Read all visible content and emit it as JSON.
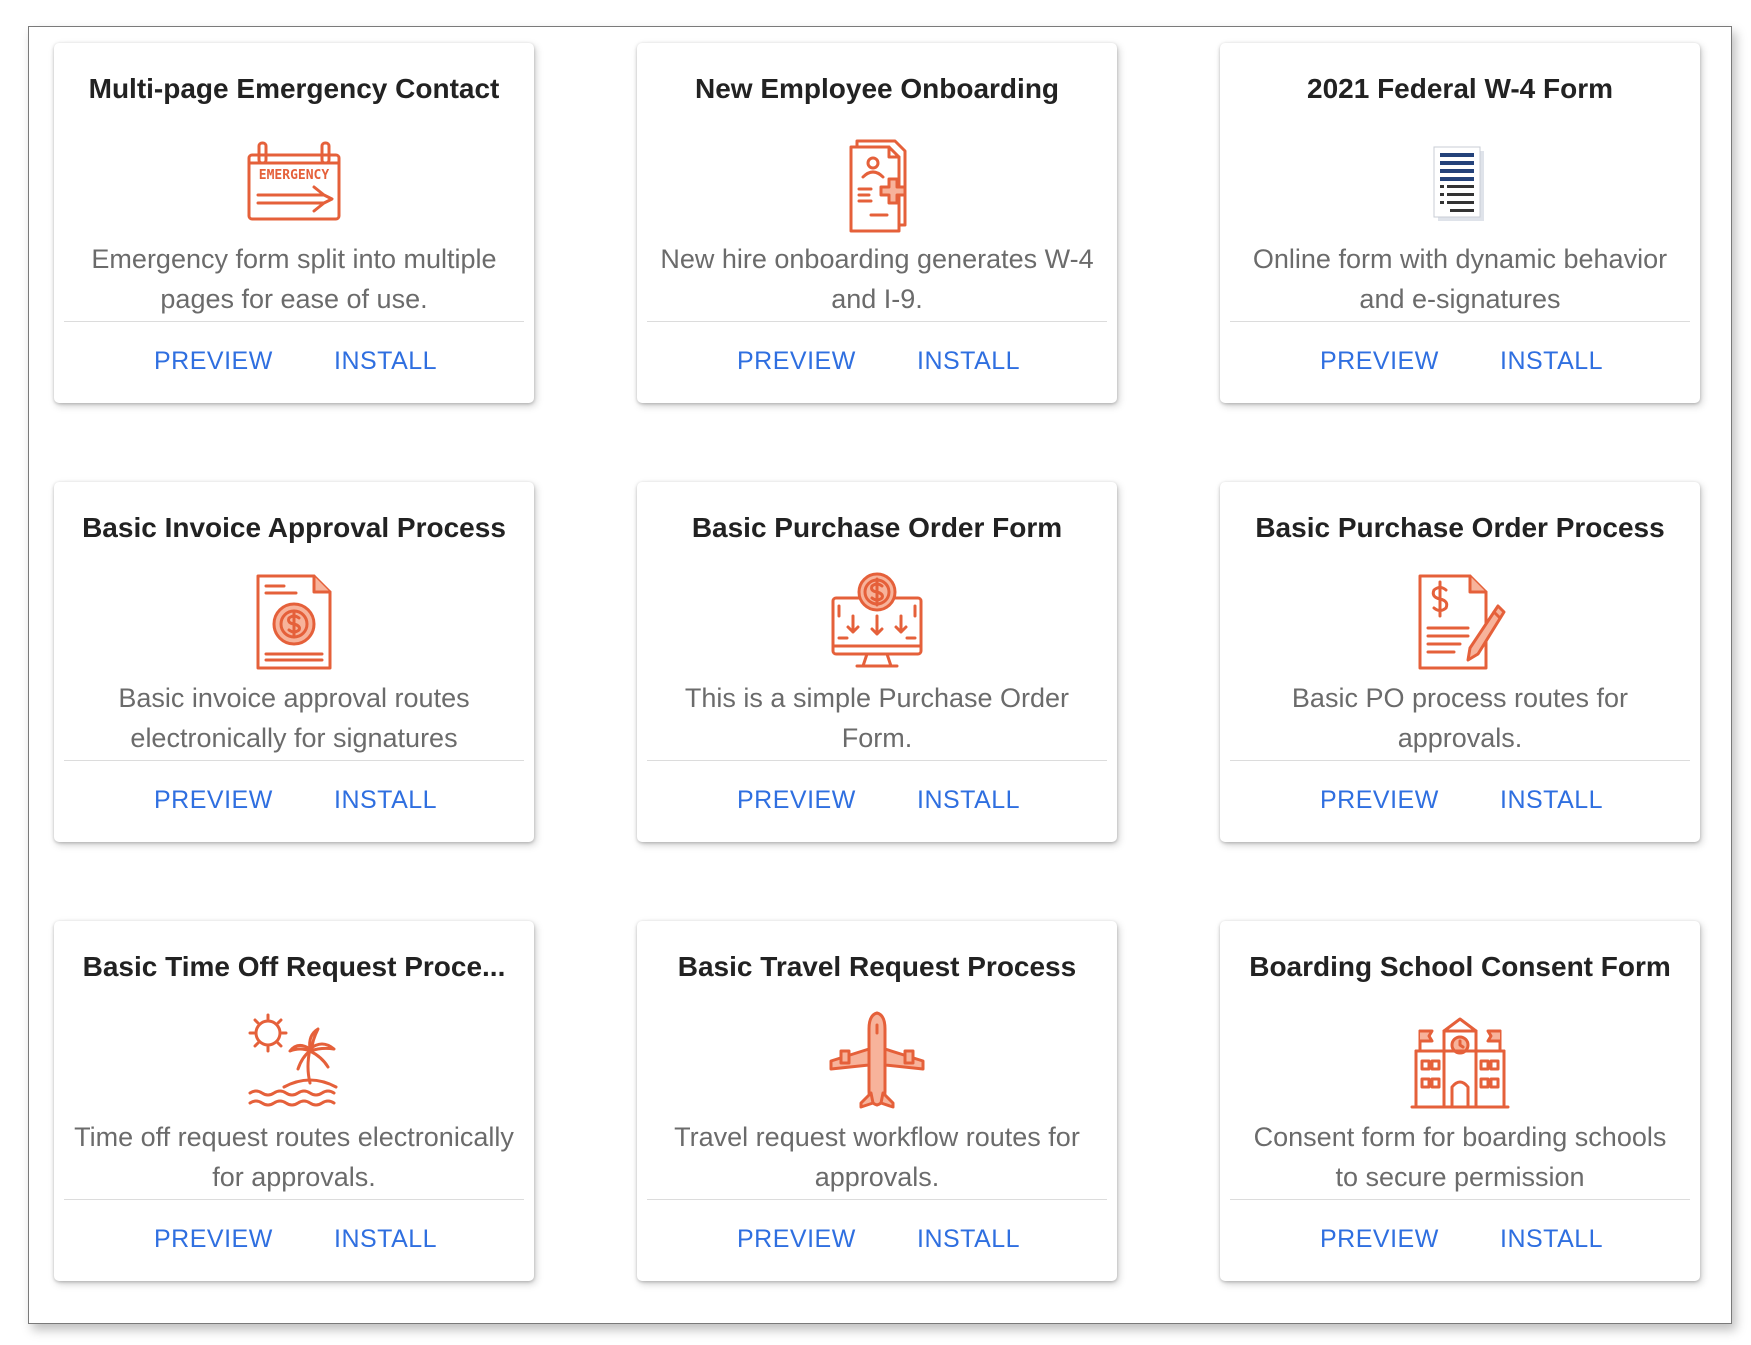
{
  "colors": {
    "accent_icon": "#e5603a",
    "icon_fill_light": "#f7b39b",
    "link": "#2f6fe0",
    "title_text": "#222222",
    "desc_text": "#6b6b6b"
  },
  "cards": [
    {
      "title": "Multi-page Emergency Contact",
      "icon": "emergency-sign-icon",
      "description": "Emergency form split into multiple pages for ease of use.",
      "preview_label": "PREVIEW",
      "install_label": "INSTALL",
      "icon_text": "EMERGENCY"
    },
    {
      "title": "New Employee Onboarding",
      "icon": "medical-document-icon",
      "description": "New hire onboarding generates W-4 and I-9.",
      "preview_label": "PREVIEW",
      "install_label": "INSTALL"
    },
    {
      "title": "2021 Federal W-4 Form",
      "icon": "document-lines-icon",
      "description": "Online form with dynamic behavior and e-signatures",
      "preview_label": "PREVIEW",
      "install_label": "INSTALL"
    },
    {
      "title": "Basic Invoice Approval Process",
      "icon": "invoice-dollar-icon",
      "description": "Basic invoice approval routes electronically for signatures",
      "preview_label": "PREVIEW",
      "install_label": "INSTALL"
    },
    {
      "title": "Basic Purchase Order Form",
      "icon": "computer-dollar-icon",
      "description": "This is a simple Purchase Order Form.",
      "preview_label": "PREVIEW",
      "install_label": "INSTALL"
    },
    {
      "title": "Basic Purchase Order Process",
      "icon": "dollar-document-pen-icon",
      "description": "Basic PO process routes for approvals.",
      "preview_label": "PREVIEW",
      "install_label": "INSTALL"
    },
    {
      "title": "Basic Time Off Request Proce...",
      "icon": "beach-palm-icon",
      "description": "Time off request routes electronically for approvals.",
      "preview_label": "PREVIEW",
      "install_label": "INSTALL"
    },
    {
      "title": "Basic Travel Request Process",
      "icon": "airplane-icon",
      "description": "Travel request workflow routes for approvals.",
      "preview_label": "PREVIEW",
      "install_label": "INSTALL"
    },
    {
      "title": "Boarding School Consent Form",
      "icon": "school-building-icon",
      "description": "Consent form for boarding schools to secure permission",
      "preview_label": "PREVIEW",
      "install_label": "INSTALL"
    }
  ]
}
